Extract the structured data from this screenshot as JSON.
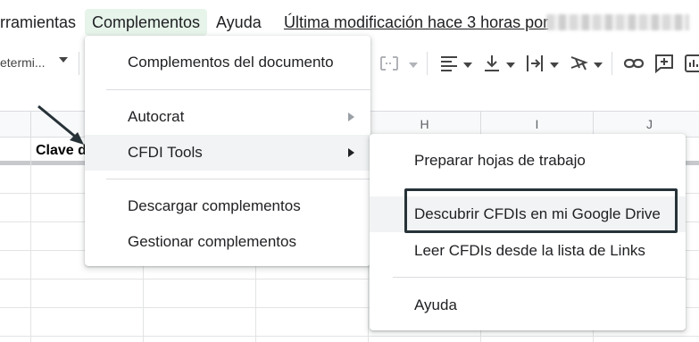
{
  "menubar": {
    "herramientas": "rramientas",
    "complementos": "Complementos",
    "ayuda": "Ayuda",
    "last_edit": "Última modificación hace 3 horas por"
  },
  "toolbar": {
    "font_label": "etermi..."
  },
  "sheet": {
    "columns": [
      "H",
      "I",
      "J"
    ],
    "cell_b1": "Clave d"
  },
  "menu_complementos": {
    "items": [
      "Complementos del documento",
      "Autocrat",
      "CFDI Tools",
      "Descargar complementos",
      "Gestionar complementos"
    ]
  },
  "menu_cfdi": {
    "items": [
      "Preparar hojas de trabajo",
      "Descubrir CFDIs en mi Google Drive",
      "Leer CFDIs desde la lista de Links",
      "Ayuda"
    ]
  },
  "colors": {
    "highlight": "#f1f3f4",
    "menu_active": "#e6f4ea",
    "focus_border": "#263238"
  },
  "icons": [
    "chevron-down-icon",
    "align-left-icon",
    "valign-bottom-icon",
    "text-wrap-icon",
    "text-rotate-icon",
    "link-icon",
    "comment-icon",
    "chart-icon",
    "merge-cells-icon"
  ]
}
